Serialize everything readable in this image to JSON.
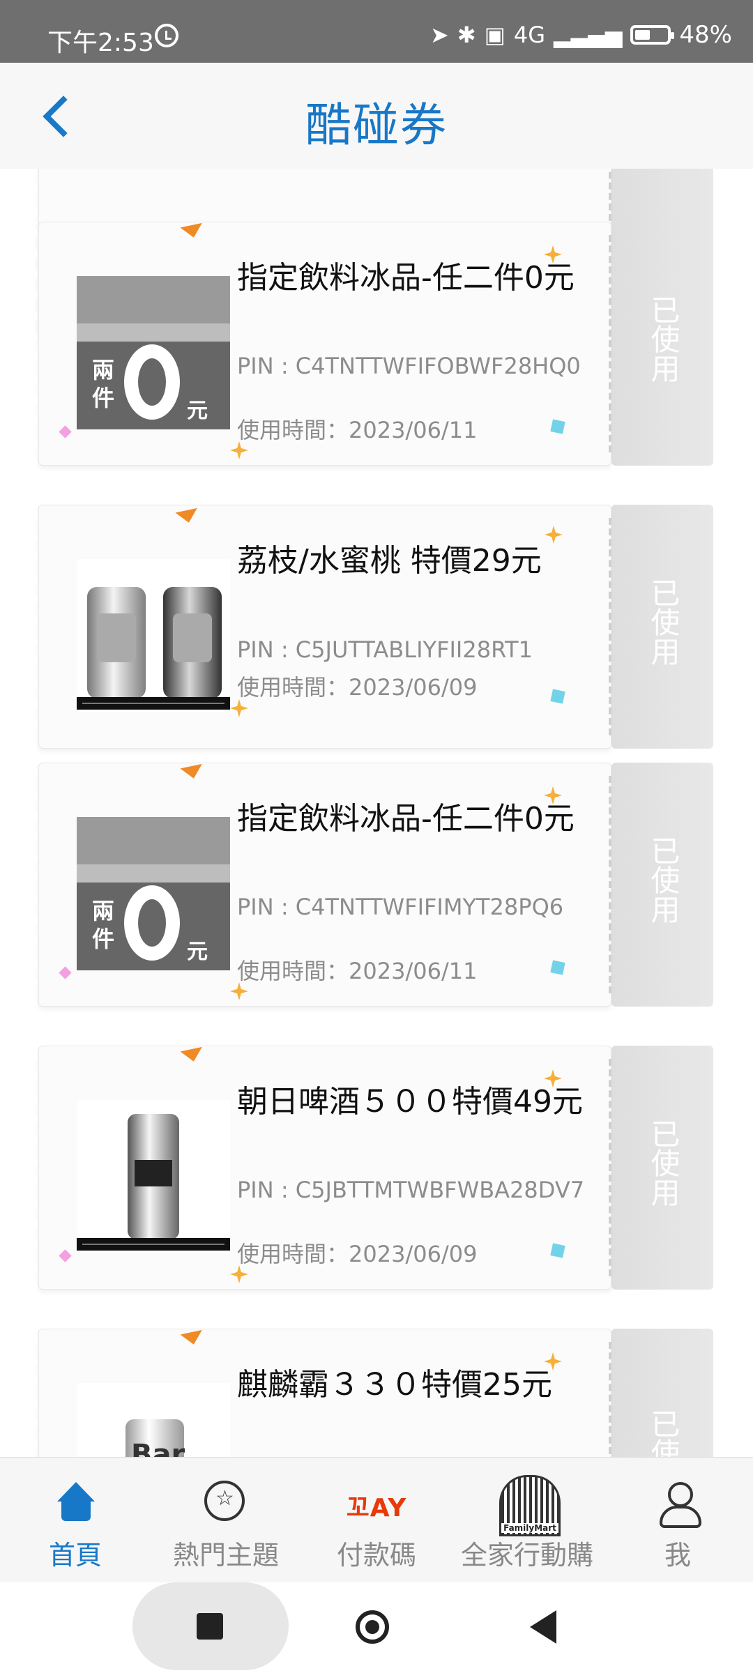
{
  "status": {
    "time": "下午2:53",
    "network": "4G",
    "battery": "48%",
    "battery_level": 0.48
  },
  "header": {
    "title": "酷碰券",
    "back_icon": "chevron-left-icon"
  },
  "coupons": [
    {
      "name": "指定飲料冰品-任二件0元",
      "pin": "PIN : C4TNTTWFIFOBWF28HQ0",
      "used_time": "使用時間：2023/06/11",
      "status": "已使用",
      "image": "two-items-zero-dollar"
    },
    {
      "name": "荔枝/水蜜桃 特價29元",
      "pin": "PIN : C5JUTTABLIYFII28RT1",
      "used_time": "使用時間：2023/06/09",
      "status": "已使用",
      "image": "beer-cans"
    },
    {
      "name": "指定飲料冰品-任二件0元",
      "pin": "PIN : C4TNTTWFIFIMYT28PQ6",
      "used_time": "使用時間：2023/06/11",
      "status": "已使用",
      "image": "two-items-zero-dollar"
    },
    {
      "name": "朝日啤酒５００特價49元",
      "pin": "PIN : C5JBTTMTWBFWBA28DV7",
      "used_time": "使用時間：2023/06/09",
      "status": "已使用",
      "image": "asahi-can"
    },
    {
      "name": "麒麟霸３３０特價25元",
      "pin": "",
      "used_time": "",
      "status": "已使",
      "image": "bar-can"
    }
  ],
  "nav": [
    {
      "label": "首頁",
      "icon": "home-icon",
      "active": true
    },
    {
      "label": "熱門主題",
      "icon": "star-circle-icon"
    },
    {
      "label": "付款碼",
      "icon": "pay-logo-icon",
      "icon_text": "꼬AY"
    },
    {
      "label": "全家行動購",
      "icon": "familymart-barcode-icon",
      "icon_text": "FamilyMart"
    },
    {
      "label": "我",
      "icon": "profile-icon"
    }
  ],
  "colors": {
    "accent": "#1878c8",
    "status_bar": "#6f6f6f",
    "stub": "#dedede"
  }
}
